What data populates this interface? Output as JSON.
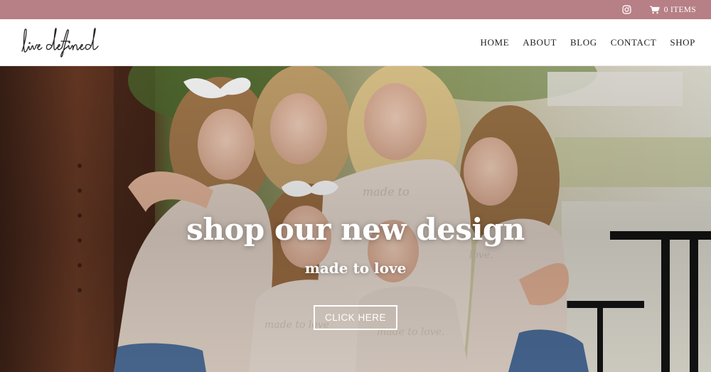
{
  "brand": {
    "logo_text": "live defined",
    "accent_color": "#b77f86"
  },
  "topbar": {
    "social_icon": "instagram-icon",
    "cart_icon": "shopping-cart-icon",
    "cart_label": "0 ITEMS"
  },
  "nav": {
    "items": [
      {
        "label": "HOME"
      },
      {
        "label": "ABOUT"
      },
      {
        "label": "BLOG"
      },
      {
        "label": "CONTACT"
      },
      {
        "label": "SHOP"
      }
    ]
  },
  "hero": {
    "title": "shop our new design",
    "subtitle": "made to love",
    "button_label": "CLICK HERE",
    "shirt_print": "made to love."
  }
}
